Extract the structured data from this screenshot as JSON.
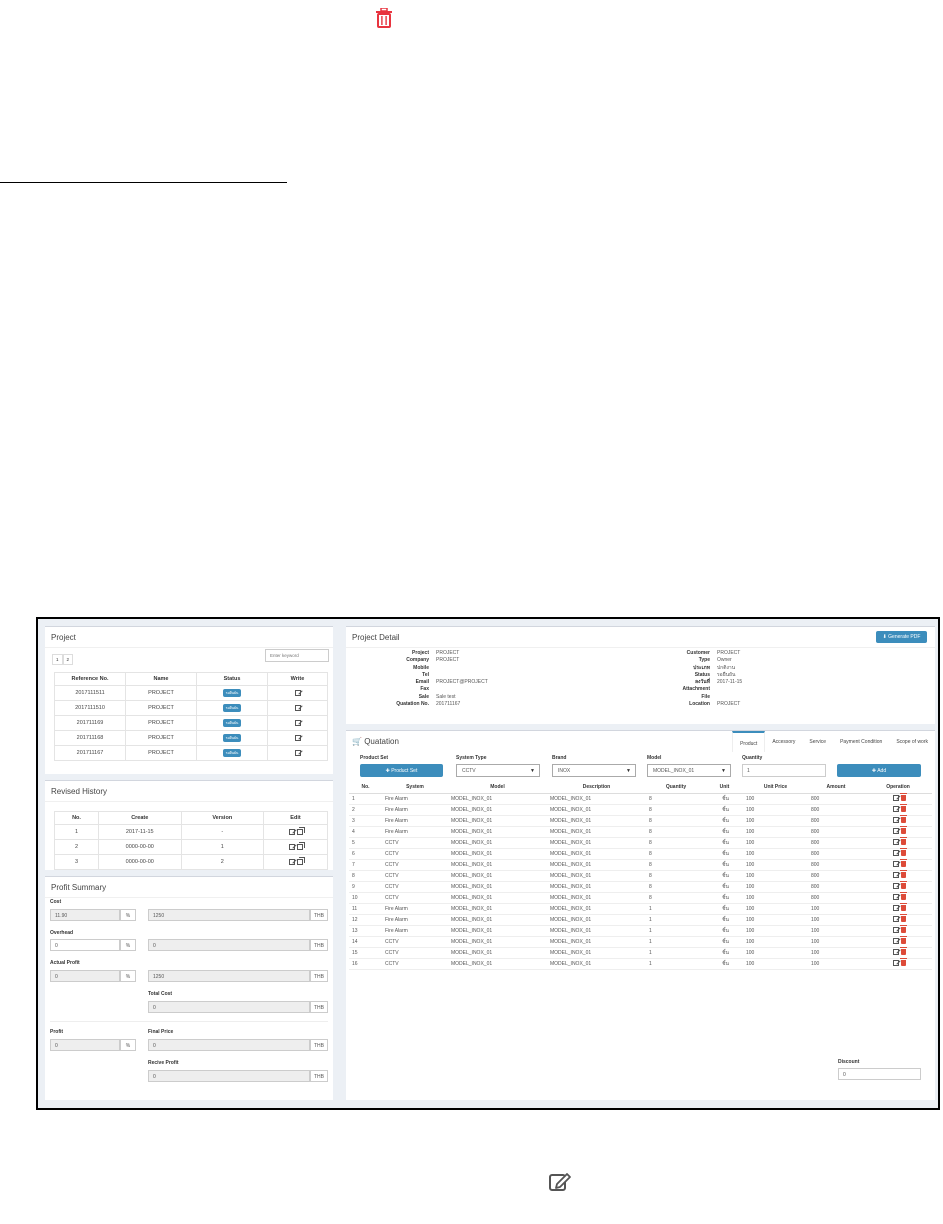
{
  "project_panel": {
    "title": "Project",
    "pages": [
      "1",
      "2"
    ],
    "search_placeholder": "Enter keyword",
    "columns": [
      "Reference No.",
      "Name",
      "Status",
      "Write"
    ],
    "rows": [
      {
        "ref": "2017111511",
        "name": "PROJECT",
        "status": "รอยืนยัน"
      },
      {
        "ref": "2017111510",
        "name": "PROJECT",
        "status": "รอยืนยัน"
      },
      {
        "ref": "201711169",
        "name": "PROJECT",
        "status": "รอยืนยัน"
      },
      {
        "ref": "201711168",
        "name": "PROJECT",
        "status": "รอยืนยัน"
      },
      {
        "ref": "201711167",
        "name": "PROJECT",
        "status": "รอยืนยัน"
      }
    ]
  },
  "revised_history": {
    "title": "Revised History",
    "columns": [
      "No.",
      "Create",
      "Version",
      "Edit"
    ],
    "rows": [
      {
        "no": "1",
        "create": "2017-11-15",
        "version": "-"
      },
      {
        "no": "2",
        "create": "0000-00-00",
        "version": "1"
      },
      {
        "no": "3",
        "create": "0000-00-00",
        "version": "2"
      }
    ]
  },
  "profit_summary": {
    "title": "Profit Summary",
    "cost_label": "Cost",
    "cost_percent": "11.90",
    "cost_amount": "1250",
    "overhead_label": "Overhead",
    "overhead_percent": "0",
    "overhead_amount": "0",
    "actual_profit_label": "Actual Profit",
    "actual_profit_percent": "0",
    "actual_profit_amount": "1250",
    "total_cost_label": "Total Cost",
    "total_cost": "0",
    "profit_label": "Profit",
    "profit_percent": "0",
    "final_price_label": "Final Price",
    "final_price": "0",
    "recive_profit_label": "Recive Profit",
    "recive_profit": "0",
    "percent_unit": "%",
    "currency": "THB"
  },
  "project_detail": {
    "title": "Project Detail",
    "generate_pdf": "Generate PDF",
    "left": [
      {
        "k": "Project",
        "v": "PROJECT"
      },
      {
        "k": "Company",
        "v": "PROJECT"
      },
      {
        "k": "Mobile",
        "v": ""
      },
      {
        "k": "Tel",
        "v": ""
      },
      {
        "k": "Email",
        "v": "PROJECT@PROJECT"
      },
      {
        "k": "Fax",
        "v": ""
      },
      {
        "k": "Sale",
        "v": "Sale test"
      },
      {
        "k": "Quatation No.",
        "v": "201711167"
      }
    ],
    "right": [
      {
        "k": "Customer",
        "v": "PROJECT"
      },
      {
        "k": "Type",
        "v": "Owner"
      },
      {
        "k": "ประเภท",
        "v": "ปกติงาน"
      },
      {
        "k": "Status",
        "v": "รอยืนยัน"
      },
      {
        "k": "ลงวันที่",
        "v": "2017-11-15"
      },
      {
        "k": "Attachment",
        "v": ""
      },
      {
        "k": "File",
        "v": ""
      },
      {
        "k": "Location",
        "v": "PROJECT"
      }
    ]
  },
  "quotation": {
    "title": "Quatation",
    "tabs": [
      "Product",
      "Accessory",
      "Service",
      "Payment Condition",
      "Scope of work"
    ],
    "product_set_label": "Product Set",
    "product_set_button": "Product Set",
    "system_type_label": "System Type",
    "system_type_value": "CCTV",
    "brand_label": "Brand",
    "brand_value": "INOX",
    "model_label": "Model",
    "model_value": "MODEL_INOX_01",
    "quantity_label": "Quantity",
    "quantity_value": "1",
    "add_button": "Add",
    "columns": [
      "No.",
      "System",
      "Model",
      "Description",
      "Quantity",
      "Unit",
      "Unit Price",
      "Amount",
      "Operation"
    ],
    "rows": [
      {
        "no": "1",
        "system": "Fire Alarm",
        "model": "MODEL_INOX_01",
        "desc": "MODEL_INOX_01",
        "qty": "8",
        "unit": "ชิ้น",
        "price": "100",
        "amount": "800"
      },
      {
        "no": "2",
        "system": "Fire Alarm",
        "model": "MODEL_INOX_01",
        "desc": "MODEL_INOX_01",
        "qty": "8",
        "unit": "ชิ้น",
        "price": "100",
        "amount": "800"
      },
      {
        "no": "3",
        "system": "Fire Alarm",
        "model": "MODEL_INOX_01",
        "desc": "MODEL_INOX_01",
        "qty": "8",
        "unit": "ชิ้น",
        "price": "100",
        "amount": "800"
      },
      {
        "no": "4",
        "system": "Fire Alarm",
        "model": "MODEL_INOX_01",
        "desc": "MODEL_INOX_01",
        "qty": "8",
        "unit": "ชิ้น",
        "price": "100",
        "amount": "800"
      },
      {
        "no": "5",
        "system": "CCTV",
        "model": "MODEL_INOX_01",
        "desc": "MODEL_INOX_01",
        "qty": "8",
        "unit": "ชิ้น",
        "price": "100",
        "amount": "800"
      },
      {
        "no": "6",
        "system": "CCTV",
        "model": "MODEL_INOX_01",
        "desc": "MODEL_INOX_01",
        "qty": "8",
        "unit": "ชิ้น",
        "price": "100",
        "amount": "800"
      },
      {
        "no": "7",
        "system": "CCTV",
        "model": "MODEL_INOX_01",
        "desc": "MODEL_INOX_01",
        "qty": "8",
        "unit": "ชิ้น",
        "price": "100",
        "amount": "800"
      },
      {
        "no": "8",
        "system": "CCTV",
        "model": "MODEL_INOX_01",
        "desc": "MODEL_INOX_01",
        "qty": "8",
        "unit": "ชิ้น",
        "price": "100",
        "amount": "800"
      },
      {
        "no": "9",
        "system": "CCTV",
        "model": "MODEL_INOX_01",
        "desc": "MODEL_INOX_01",
        "qty": "8",
        "unit": "ชิ้น",
        "price": "100",
        "amount": "800"
      },
      {
        "no": "10",
        "system": "CCTV",
        "model": "MODEL_INOX_01",
        "desc": "MODEL_INOX_01",
        "qty": "8",
        "unit": "ชิ้น",
        "price": "100",
        "amount": "800"
      },
      {
        "no": "11",
        "system": "Fire Alarm",
        "model": "MODEL_INOX_01",
        "desc": "MODEL_INOX_01",
        "qty": "1",
        "unit": "ชิ้น",
        "price": "100",
        "amount": "100"
      },
      {
        "no": "12",
        "system": "Fire Alarm",
        "model": "MODEL_INOX_01",
        "desc": "MODEL_INOX_01",
        "qty": "1",
        "unit": "ชิ้น",
        "price": "100",
        "amount": "100"
      },
      {
        "no": "13",
        "system": "Fire Alarm",
        "model": "MODEL_INOX_01",
        "desc": "MODEL_INOX_01",
        "qty": "1",
        "unit": "ชิ้น",
        "price": "100",
        "amount": "100"
      },
      {
        "no": "14",
        "system": "CCTV",
        "model": "MODEL_INOX_01",
        "desc": "MODEL_INOX_01",
        "qty": "1",
        "unit": "ชิ้น",
        "price": "100",
        "amount": "100"
      },
      {
        "no": "15",
        "system": "CCTV",
        "model": "MODEL_INOX_01",
        "desc": "MODEL_INOX_01",
        "qty": "1",
        "unit": "ชิ้น",
        "price": "100",
        "amount": "100"
      },
      {
        "no": "16",
        "system": "CCTV",
        "model": "MODEL_INOX_01",
        "desc": "MODEL_INOX_01",
        "qty": "1",
        "unit": "ชิ้น",
        "price": "100",
        "amount": "100"
      }
    ],
    "discount_label": "Discount",
    "discount_value": "0"
  },
  "colors": {
    "primary": "#3c8dbc",
    "danger": "#dd4b39",
    "background": "#ecf0f5"
  }
}
